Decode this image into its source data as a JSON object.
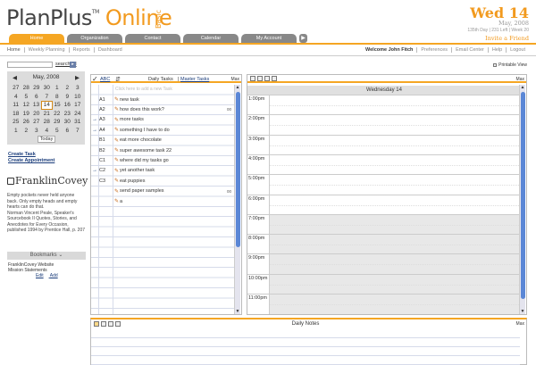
{
  "brand": {
    "name": "PlanPlus",
    "tm": "TM",
    "online": "Online",
    "edition": "Basic"
  },
  "header_date": {
    "weekday": "Wed",
    "day": "14",
    "month_year": "May, 2008",
    "stats": "135th Day | 231 Left | Week 20",
    "invite": "Invite a Friend"
  },
  "tabs": [
    "Home",
    "Organization",
    "Contact",
    "Calendar",
    "My Account"
  ],
  "tab_more": "▶",
  "subnav": [
    "Home",
    "Weekly Planning",
    "Reports",
    "Dashboard"
  ],
  "usernav": [
    "Welcome John Fitch",
    "Preferences",
    "Email Center",
    "Help",
    "Logout"
  ],
  "search": {
    "placeholder": "",
    "link": "search all",
    "button": "▸"
  },
  "mini_cal": {
    "prev": "◀",
    "title": "May, 2008",
    "next": "▶",
    "weeks": [
      [
        "27",
        "28",
        "29",
        "30",
        "1",
        "2",
        "3"
      ],
      [
        "4",
        "5",
        "6",
        "7",
        "8",
        "9",
        "10"
      ],
      [
        "11",
        "12",
        "13",
        "14",
        "15",
        "16",
        "17"
      ],
      [
        "18",
        "19",
        "20",
        "21",
        "22",
        "23",
        "24"
      ],
      [
        "25",
        "26",
        "27",
        "28",
        "29",
        "30",
        "31"
      ],
      [
        "1",
        "2",
        "3",
        "4",
        "5",
        "6",
        "7"
      ]
    ],
    "today_label": "Today",
    "selected": "14"
  },
  "side_links": {
    "create_task": "Create Task",
    "create_appointment": "Create Appointment"
  },
  "franklin": {
    "name": "FranklinCovey",
    "quote": "Empty pockets never held anyone back. Only empty heads and empty hearts can do that.",
    "attribution": "Norman Vincent Peale, Speaker's Sourcebook II Quotes, Stories, and Anecdotes for Every Occasion, published 1994 by Prentice Hall, p. 207"
  },
  "bookmarks": {
    "title": "Bookmarks",
    "chevron": "⌄",
    "items": [
      "FranklinCovey Website",
      "Mission Statements"
    ],
    "edit": "Edit",
    "add": "Add"
  },
  "printable": "Printable View",
  "tasks": {
    "check": "✓",
    "abc": "ABC",
    "title": "Daily Tasks",
    "sep": "|",
    "master": "Master Tasks",
    "max": "Max",
    "add_hint": "Click here to add a new Task",
    "rows": [
      {
        "arrow": "",
        "priority": "A1",
        "text": "new task",
        "note": ""
      },
      {
        "arrow": "",
        "priority": "A2",
        "text": "how does this work?",
        "note": "00"
      },
      {
        "arrow": "→",
        "priority": "A3",
        "text": "more tasks",
        "note": ""
      },
      {
        "arrow": "→",
        "priority": "A4",
        "text": "something I have to do",
        "note": ""
      },
      {
        "arrow": "",
        "priority": "B1",
        "text": "eat more chocolate",
        "note": ""
      },
      {
        "arrow": "",
        "priority": "B2",
        "text": "super awesome task 22",
        "note": ""
      },
      {
        "arrow": "",
        "priority": "C1",
        "text": "where did my tasks go",
        "note": ""
      },
      {
        "arrow": "→",
        "priority": "C2",
        "text": "yet another task",
        "note": ""
      },
      {
        "arrow": "",
        "priority": "C3",
        "text": "eat puppies",
        "note": ""
      },
      {
        "arrow": "",
        "priority": "",
        "text": "send paper samples",
        "note": "00"
      },
      {
        "arrow": "",
        "priority": "",
        "text": "a",
        "note": ""
      }
    ]
  },
  "day_view": {
    "title": "Wednesday 14",
    "max": "Max",
    "hours": [
      "1:00pm",
      "2:00pm",
      "3:00pm",
      "4:00pm",
      "5:00pm",
      "6:00pm",
      "7:00pm",
      "8:00pm",
      "9:00pm",
      "10:00pm",
      "11:00pm"
    ],
    "evening_from_index": 6
  },
  "notes": {
    "title": "Daily Notes",
    "max": "Max"
  },
  "colors": {
    "accent": "#f5a623",
    "tab_inactive": "#888888",
    "link": "#1a3c7a",
    "scroll_thumb": "#5b87d6"
  }
}
